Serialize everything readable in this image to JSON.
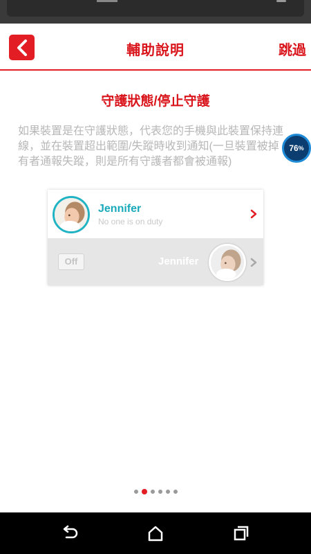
{
  "header": {
    "title": "輔助說明",
    "skip_label": "跳過"
  },
  "content": {
    "section_title": "守護狀態/停止守護",
    "description": "如果裝置是在守護狀態，代表您的手機與此裝置保持連\n線，並在裝置超出範圍/失蹤時收到通知(一旦裝置被掉\n有者通報失蹤，則是所有守護者都會被通報)"
  },
  "overlay_badge": {
    "value": "76",
    "unit": "%"
  },
  "card": {
    "row1": {
      "name": "Jennifer",
      "status": "No one is on duty"
    },
    "row2": {
      "toggle_label": "Off",
      "name": "Jennifer"
    }
  },
  "pager": {
    "total": 6,
    "active_index": 1
  },
  "colors": {
    "accent": "#e21d24",
    "teal": "#1fb3c4",
    "muted_text": "#b7b7b7"
  },
  "icons": {
    "back": "chevron-left-icon",
    "row_arrow": "chevron-right-icon",
    "nav_back": "back-arrow-icon",
    "nav_home": "home-icon",
    "nav_recents": "recents-icon"
  }
}
